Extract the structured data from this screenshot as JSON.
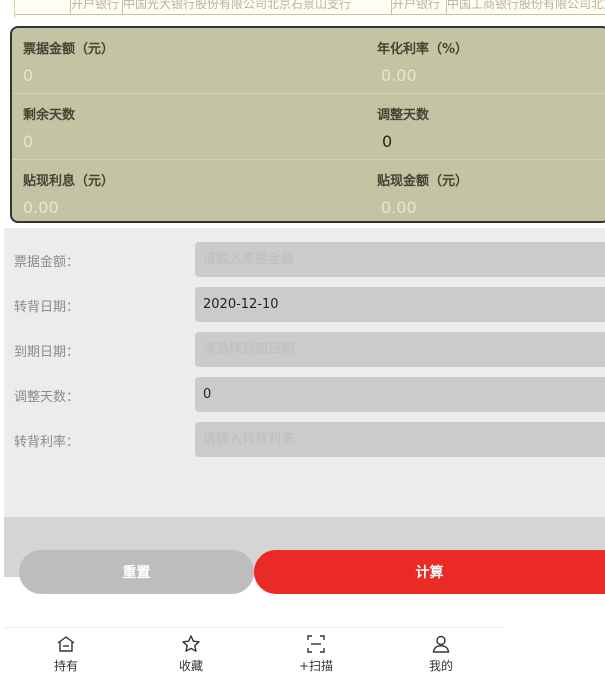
{
  "bill_strip": {
    "cells": [
      "开户银行",
      "中国光大银行股份有限公司北京石景山支行",
      "开户银行",
      "中国工商银行股份有限公司北京"
    ]
  },
  "result_card": {
    "face_amount_label": "票据金额（元）",
    "face_amount_value": "0",
    "annual_rate_label": "年化利率（%）",
    "annual_rate_value": "0.00",
    "remaining_days_label": "剩余天数",
    "remaining_days_value": "0",
    "adjust_days_label": "调整天数",
    "adjust_days_value": "0",
    "discount_interest_label": "贴现利息（元）",
    "discount_interest_value": "0.00",
    "discount_amount_label": "贴现金额（元）",
    "discount_amount_value": "0.00"
  },
  "form": {
    "face_amount": {
      "label": "票据金额：",
      "value": "",
      "placeholder": "请输入票据金额"
    },
    "transfer_date": {
      "label": "转背日期：",
      "value": "2020-12-10",
      "placeholder": ""
    },
    "due_date": {
      "label": "到期日期：",
      "value": "",
      "placeholder": "请选择到期日期"
    },
    "adjust_days": {
      "label": "调整天数：",
      "value": "0",
      "placeholder": ""
    },
    "transfer_rate": {
      "label": "转背利率：",
      "value": "",
      "placeholder": "请输入转背利率"
    }
  },
  "buttons": {
    "reset": "重置",
    "calculate": "计算"
  },
  "colors": {
    "primary": "#ea2a25",
    "card_bg": "#c3c4a3",
    "reset_bg": "#bdbdbd"
  },
  "nav": [
    {
      "label": "持有",
      "icon": "home-icon"
    },
    {
      "label": "收藏",
      "icon": "star-icon"
    },
    {
      "label": "+扫描",
      "icon": "scan-icon"
    },
    {
      "label": "我的",
      "icon": "user-icon"
    }
  ]
}
